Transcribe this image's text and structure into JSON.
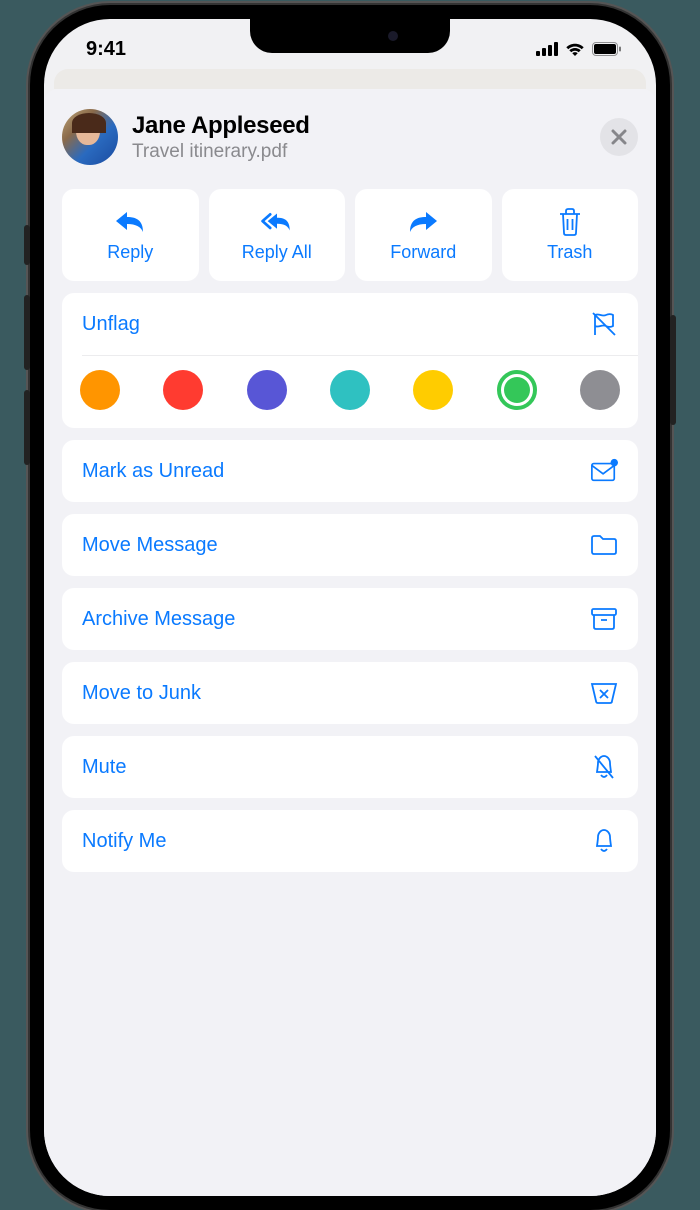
{
  "status": {
    "time": "9:41"
  },
  "header": {
    "sender": "Jane Appleseed",
    "attachment": "Travel itinerary.pdf"
  },
  "actions": {
    "reply": "Reply",
    "reply_all": "Reply All",
    "forward": "Forward",
    "trash": "Trash"
  },
  "flag": {
    "label": "Unflag",
    "colors": [
      "#ff9500",
      "#ff3b30",
      "#5856d6",
      "#2fc1c1",
      "#ffcc00",
      "#34c759",
      "#8e8e93"
    ],
    "selected_index": 5
  },
  "menu": {
    "mark_unread": "Mark as Unread",
    "move": "Move Message",
    "archive": "Archive Message",
    "junk": "Move to Junk",
    "mute": "Mute",
    "notify": "Notify Me"
  }
}
